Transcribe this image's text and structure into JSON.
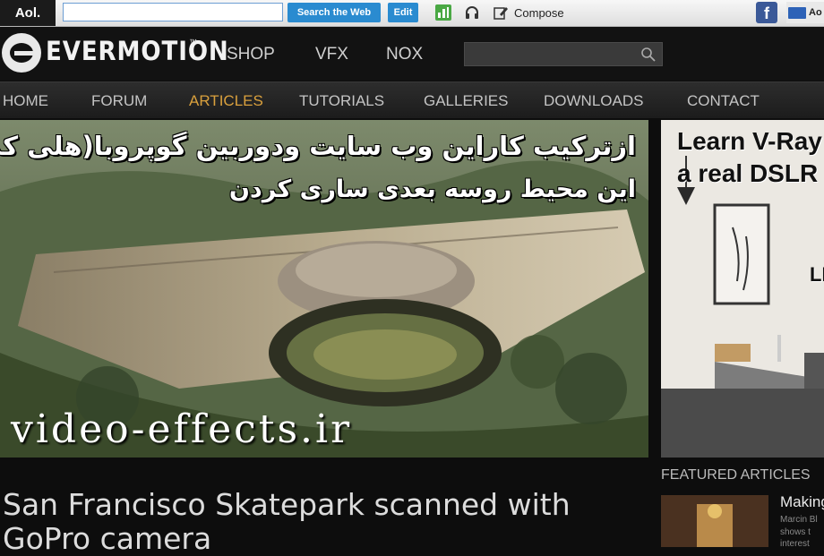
{
  "toolbar": {
    "logo": "Aol.",
    "search_value": "",
    "search_button": "Search the Web",
    "edit_button": "Edit",
    "compose_label": "Compose",
    "facebook_glyph": "f",
    "mail_label": "Ao"
  },
  "header": {
    "logo_text": "EVERMOTION",
    "logo_tm": "™",
    "top_nav": [
      "SHOP",
      "VFX",
      "NOX"
    ],
    "search_placeholder": ""
  },
  "category_nav": {
    "items": [
      "HOME",
      "FORUM",
      "ARTICLES",
      "TUTORIALS",
      "GALLERIES",
      "DOWNLOADS",
      "CONTACT"
    ],
    "active": "ARTICLES"
  },
  "hero": {
    "overlay_line1": "ازترکیب کاراین وب سایت ودوربین گوپروبا(هلی کمرا)",
    "overlay_line2": "این محیط روسه بعدی ساری کردن",
    "watermark": "video-effects.ir"
  },
  "article": {
    "title": "San Francisco Skatepark scanned with GoPro camera"
  },
  "sidebar": {
    "ad_line1": "Learn V-Ray a",
    "ad_line2": "a real DSLR c",
    "ad_line3": "LE",
    "featured_heading": "FEATURED ARTICLES",
    "featured_title": "Making",
    "featured_sub1": "Marcin Bl",
    "featured_sub2": "shows t",
    "featured_sub3": "interest"
  },
  "colors": {
    "accent": "#d9a03d",
    "aol_button": "#2a8bd0",
    "background": "#0d0d0d"
  }
}
